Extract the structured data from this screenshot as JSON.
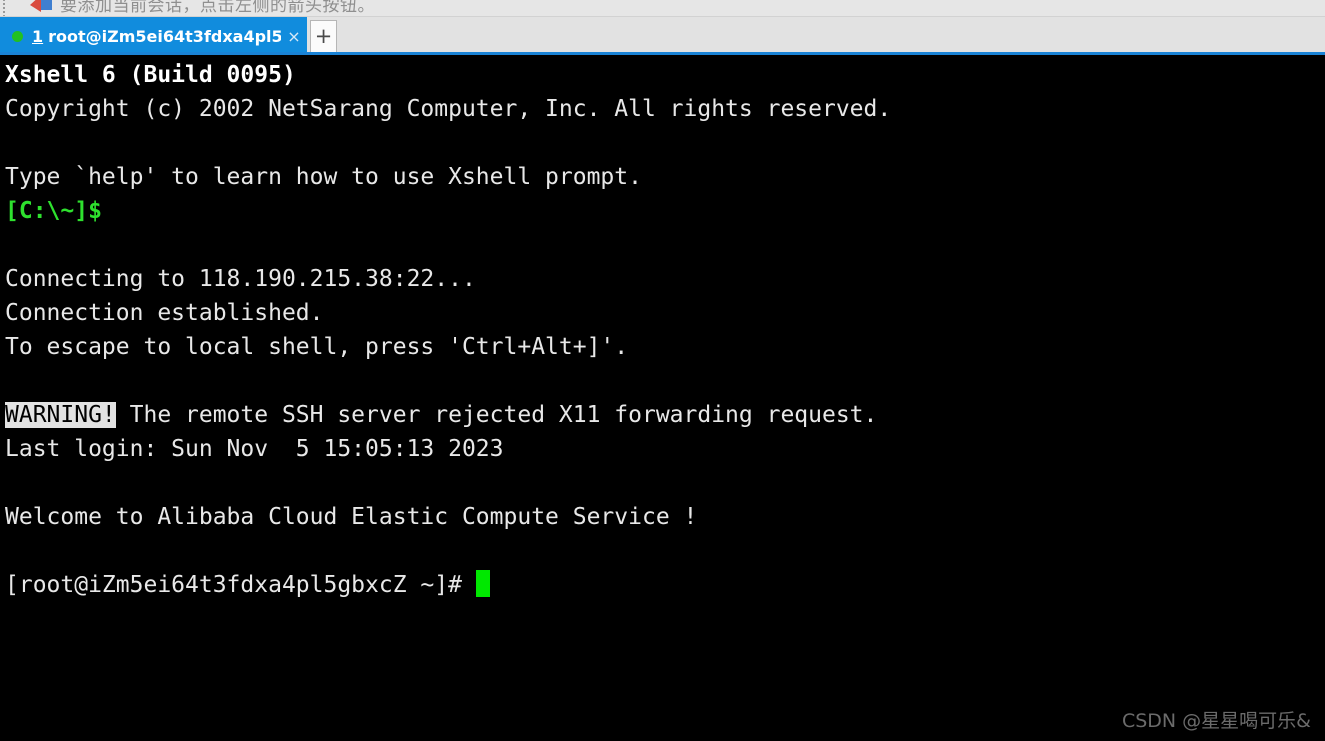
{
  "toolbar": {
    "hint_text": "要添加当前会话，点击左侧的箭头按钮。",
    "grip_name": "toolbar-grip",
    "arrow_icon": "add-session-arrow-icon"
  },
  "tab_bar": {
    "tab": {
      "index": "1",
      "title": "root@iZm5ei64t3fdxa4pl5...",
      "status_dot_color": "#22c021",
      "close_label": "×",
      "active_color": "#118cdd"
    },
    "new_tab_label": "+",
    "underline_color": "#1a83d6",
    "background_color": "#e2e2e2"
  },
  "terminal": {
    "background_color": "#000000",
    "foreground_color": "#e8e8e8",
    "green_color": "#2ee02e",
    "cursor_color": "#00e800",
    "lines": [
      {
        "id": "app-banner",
        "style": "bold",
        "text": "Xshell 6 (Build 0095)"
      },
      {
        "id": "copyright",
        "style": "normal",
        "text": "Copyright (c) 2002 NetSarang Computer, Inc. All rights reserved."
      },
      {
        "id": "blank-1",
        "style": "normal",
        "text": ""
      },
      {
        "id": "help-hint",
        "style": "normal",
        "text": "Type `help' to learn how to use Xshell prompt."
      },
      {
        "id": "local-prompt",
        "style": "green",
        "text": "[C:\\~]$"
      },
      {
        "id": "blank-2",
        "style": "normal",
        "text": ""
      },
      {
        "id": "connecting",
        "style": "normal",
        "text": "Connecting to 118.190.215.38:22..."
      },
      {
        "id": "connection-ok",
        "style": "normal",
        "text": "Connection established."
      },
      {
        "id": "escape-hint",
        "style": "normal",
        "text": "To escape to local shell, press 'Ctrl+Alt+]'."
      },
      {
        "id": "blank-3",
        "style": "normal",
        "text": ""
      },
      {
        "id": "x11-warning",
        "style": "warning",
        "warning_tag": "WARNING!",
        "text": " The remote SSH server rejected X11 forwarding request."
      },
      {
        "id": "last-login",
        "style": "normal",
        "text": "Last login: Sun Nov  5 15:05:13 2023"
      },
      {
        "id": "blank-4",
        "style": "normal",
        "text": ""
      },
      {
        "id": "welcome",
        "style": "normal",
        "text": "Welcome to Alibaba Cloud Elastic Compute Service !"
      },
      {
        "id": "blank-5",
        "style": "normal",
        "text": ""
      },
      {
        "id": "shell-prompt",
        "style": "cursor",
        "text": "[root@iZm5ei64t3fdxa4pl5gbxcZ ~]# "
      }
    ]
  },
  "watermark": {
    "text": "CSDN @星星喝可乐&"
  }
}
